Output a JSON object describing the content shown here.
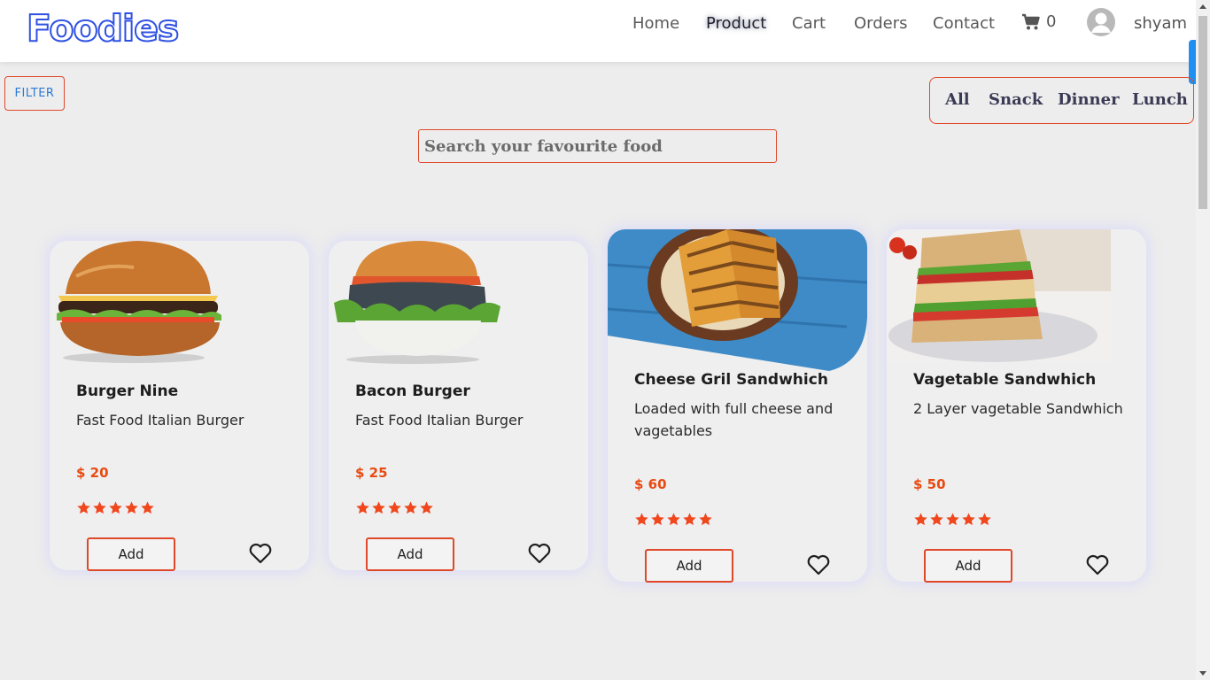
{
  "brand": {
    "logo_text": "Foodies",
    "logo_color": "#2f51e3"
  },
  "nav": {
    "items": [
      {
        "label": "Home",
        "active": false
      },
      {
        "label": "Product",
        "active": true
      },
      {
        "label": "Cart",
        "active": false
      },
      {
        "label": "Orders",
        "active": false
      },
      {
        "label": "Contact",
        "active": false
      }
    ],
    "cart_count": "0",
    "user_name": "shyam"
  },
  "filter": {
    "label": "FILTER"
  },
  "categories": [
    "All",
    "Snack",
    "Dinner",
    "Lunch"
  ],
  "search": {
    "placeholder": "Search your favourite food",
    "value": ""
  },
  "accent_color": "#e0482a",
  "price_color": "#e84a12",
  "products": [
    {
      "title": "Burger Nine",
      "description": "Fast Food Italian Burger",
      "price": "$ 20",
      "rating": 5,
      "add_label": "Add",
      "image": "burger"
    },
    {
      "title": "Bacon Burger",
      "description": "Fast Food Italian Burger",
      "price": "$ 25",
      "rating": 5,
      "add_label": "Add",
      "image": "burger"
    },
    {
      "title": "Cheese Gril Sandwhich",
      "description": "Loaded with full cheese and vagetables",
      "price": "$ 60",
      "rating": 5,
      "add_label": "Add",
      "image": "grilled-sandwich"
    },
    {
      "title": "Vagetable Sandwhich",
      "description": "2 Layer vagetable Sandwhich",
      "price": "$ 50",
      "rating": 5,
      "add_label": "Add",
      "image": "club-sandwich"
    }
  ]
}
